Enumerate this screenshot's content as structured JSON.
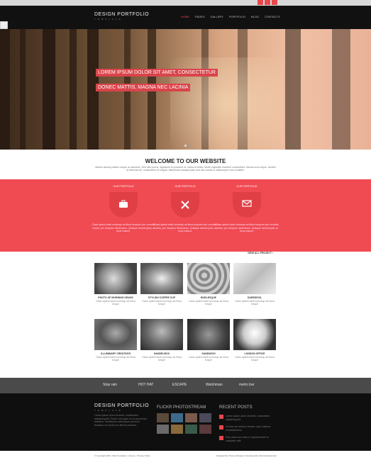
{
  "social": [
    "twitter-icon",
    "facebook-icon",
    "google-icon"
  ],
  "logo": {
    "text": "DESIGN PORTFOLIO",
    "sub": "TEMPLATE"
  },
  "nav": [
    "HOME",
    "PAGES",
    "GALLERY",
    "PORTFOLIO",
    "BLOG",
    "CONTACTS"
  ],
  "hero": {
    "line1": "LOREM IPSUM DOLOR SIT AMET, CONSECTETUR",
    "line2": "DONEC MATTIS, MAGNA NEC LACINIA"
  },
  "welcome": {
    "title": "WELCOME TO OUR WEBSITE",
    "text": "Mauris lacinia pretium neque ac faucibus. Sed nibh purus, dignissim eu posuere ut, luctus et tellus. Morbi vulputate tincidunt consectetur. Mauris urna neque, laoreet id vehicula vel, consectetur et magna. Maecenas volutpat justo sed nisi cursus in ullamcorper nunc sodales."
  },
  "services": [
    {
      "label": "OUR PORTFOLIO",
      "icon": "briefcase-icon",
      "desc": "Class aptent taciti sociosqu ad litora torquent per conubia nostra, per inceptos himenaeos. Quisque laoreet justo ut risus mauris."
    },
    {
      "label": "OUR PORTFOLIO",
      "icon": "tools-icon",
      "desc": "Class aptent taciti sociosqu ad litora torquent per conubia nostra, per inceptos himenaeos. Quisque laoreet justo ut risus mauris."
    },
    {
      "label": "OUR PORTFOLIO",
      "icon": "mail-icon",
      "desc": "Class aptent taciti sociosqu ad litora torquent per conubia nostra, per inceptos himenaeos. Quisque laoreet justo ut risus mauris."
    }
  ],
  "view_all": "VIEW ALL PROJECT ›",
  "portfolio": [
    {
      "title": "PHOTO OF MORNING GRASS",
      "txt": "Class aptent taciti sociosqu ad litora torque"
    },
    {
      "title": "STYLISH COFFEE CUP",
      "txt": "Class aptent taciti sociosqu ad litora torque"
    },
    {
      "title": "BURLESQUE",
      "txt": "Class aptent taciti sociosqu ad litora torque"
    },
    {
      "title": "DAREDEVIL",
      "txt": "Class aptent taciti sociosqu ad litora torque"
    },
    {
      "title": "ILLUMINARY CREATIVES",
      "txt": "Class aptent taciti sociosqu ad litora torque"
    },
    {
      "title": "HANDELBOX",
      "txt": "Class aptent taciti sociosqu ad litora torque"
    },
    {
      "title": "SANDWICH",
      "txt": "Class aptent taciti sociosqu ad litora torque"
    },
    {
      "title": "LONDON OFFICE",
      "txt": "Class aptent taciti sociosqu ad litora torque"
    }
  ],
  "clients": [
    "Stop rain",
    "HOT HAT",
    "ESCAPE",
    "Watchman",
    "metro bar"
  ],
  "footer": {
    "about": "Lorem ipsum dolor sit amet, consectetur adipiscing elit. Donec vel quam ut mi accumsan faucibus. Vestibulum ante ipsum primis in faucibus orci luctus et ultrices posuere.",
    "photostream": "FLICKR PHOTOSTREAM",
    "recent": "RECENT POSTS",
    "posts": [
      "Lorem ipsum dolor sit amet, consectetur adipiscing elit.",
      "Ut enim ad minima veniam, quis nostrum exercitationem",
      "Duis aute irure dolor in reprehenderit in voluptate velit"
    ]
  },
  "copyright": "© Copyright 2013. Web Templates. Licence · Privacy Policy",
  "credits": "Designed by Theme Designer. Developed by Web Development"
}
